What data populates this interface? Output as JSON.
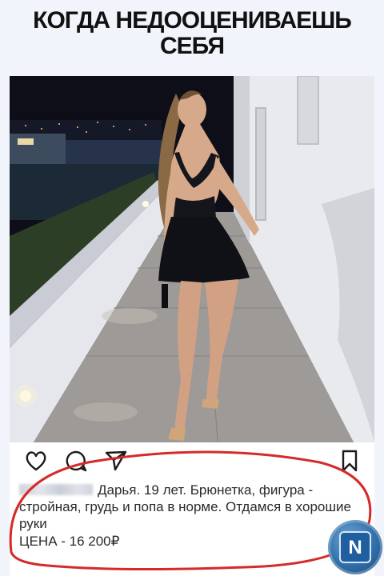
{
  "meme": {
    "title_line1": "КОГДА НЕДООЦЕНИВАЕШЬ",
    "title_line2": "СЕБЯ"
  },
  "post": {
    "photo_alt": "",
    "caption": "Дарья. 19 лет. Брюнетка, фигура - стройная, грудь и попа в норме. Отдамся в хорошие руки",
    "price": "ЦЕНА - 16 200₽",
    "icons": [
      "heart-icon",
      "comment-icon",
      "share-icon",
      "bookmark-icon"
    ]
  },
  "watermark": {
    "letter": "N"
  },
  "colors": {
    "background": "#f2f4fb",
    "annotation_red": "#d42a2a",
    "watermark_blue": "#2f6ea8"
  }
}
